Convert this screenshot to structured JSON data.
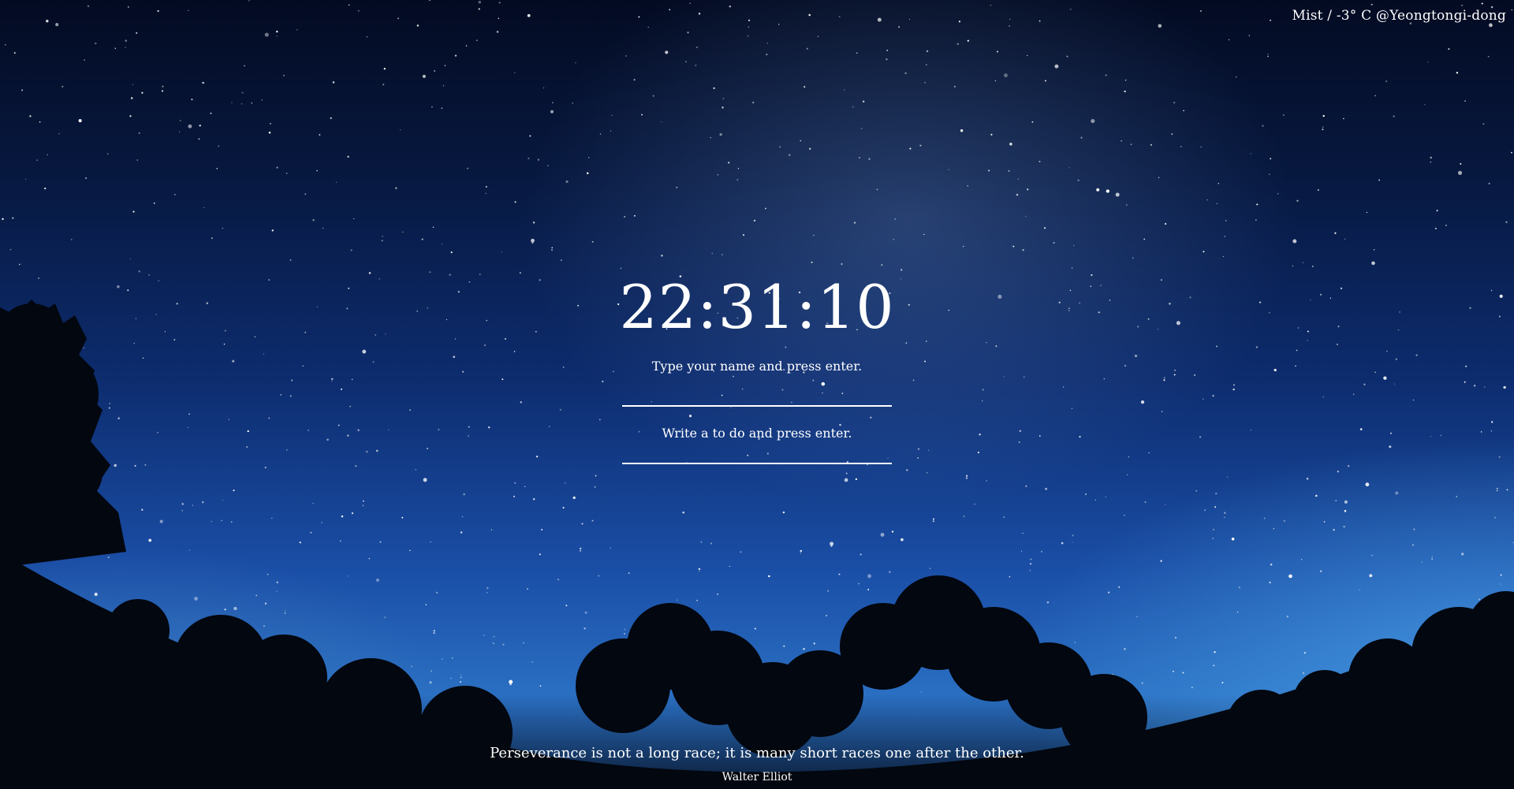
{
  "weather": {
    "condition": "Mist",
    "text": "Mist / -3° C @Yeongtongi-dong"
  },
  "clock": {
    "time": "22:31:10"
  },
  "greeting": {
    "prompt": "Type your name and press enter.",
    "value": ""
  },
  "todo": {
    "prompt": "Write a to do and press enter.",
    "value": ""
  },
  "quote": {
    "text": "Perseverance is not a long race; it is many short races one after the other.",
    "author": "Walter Elliot"
  },
  "colors": {
    "text": "#ffffff",
    "sky_top": "#030b22",
    "sky_mid": "#0d2c6e",
    "sky_low": "#2a6fc2"
  }
}
